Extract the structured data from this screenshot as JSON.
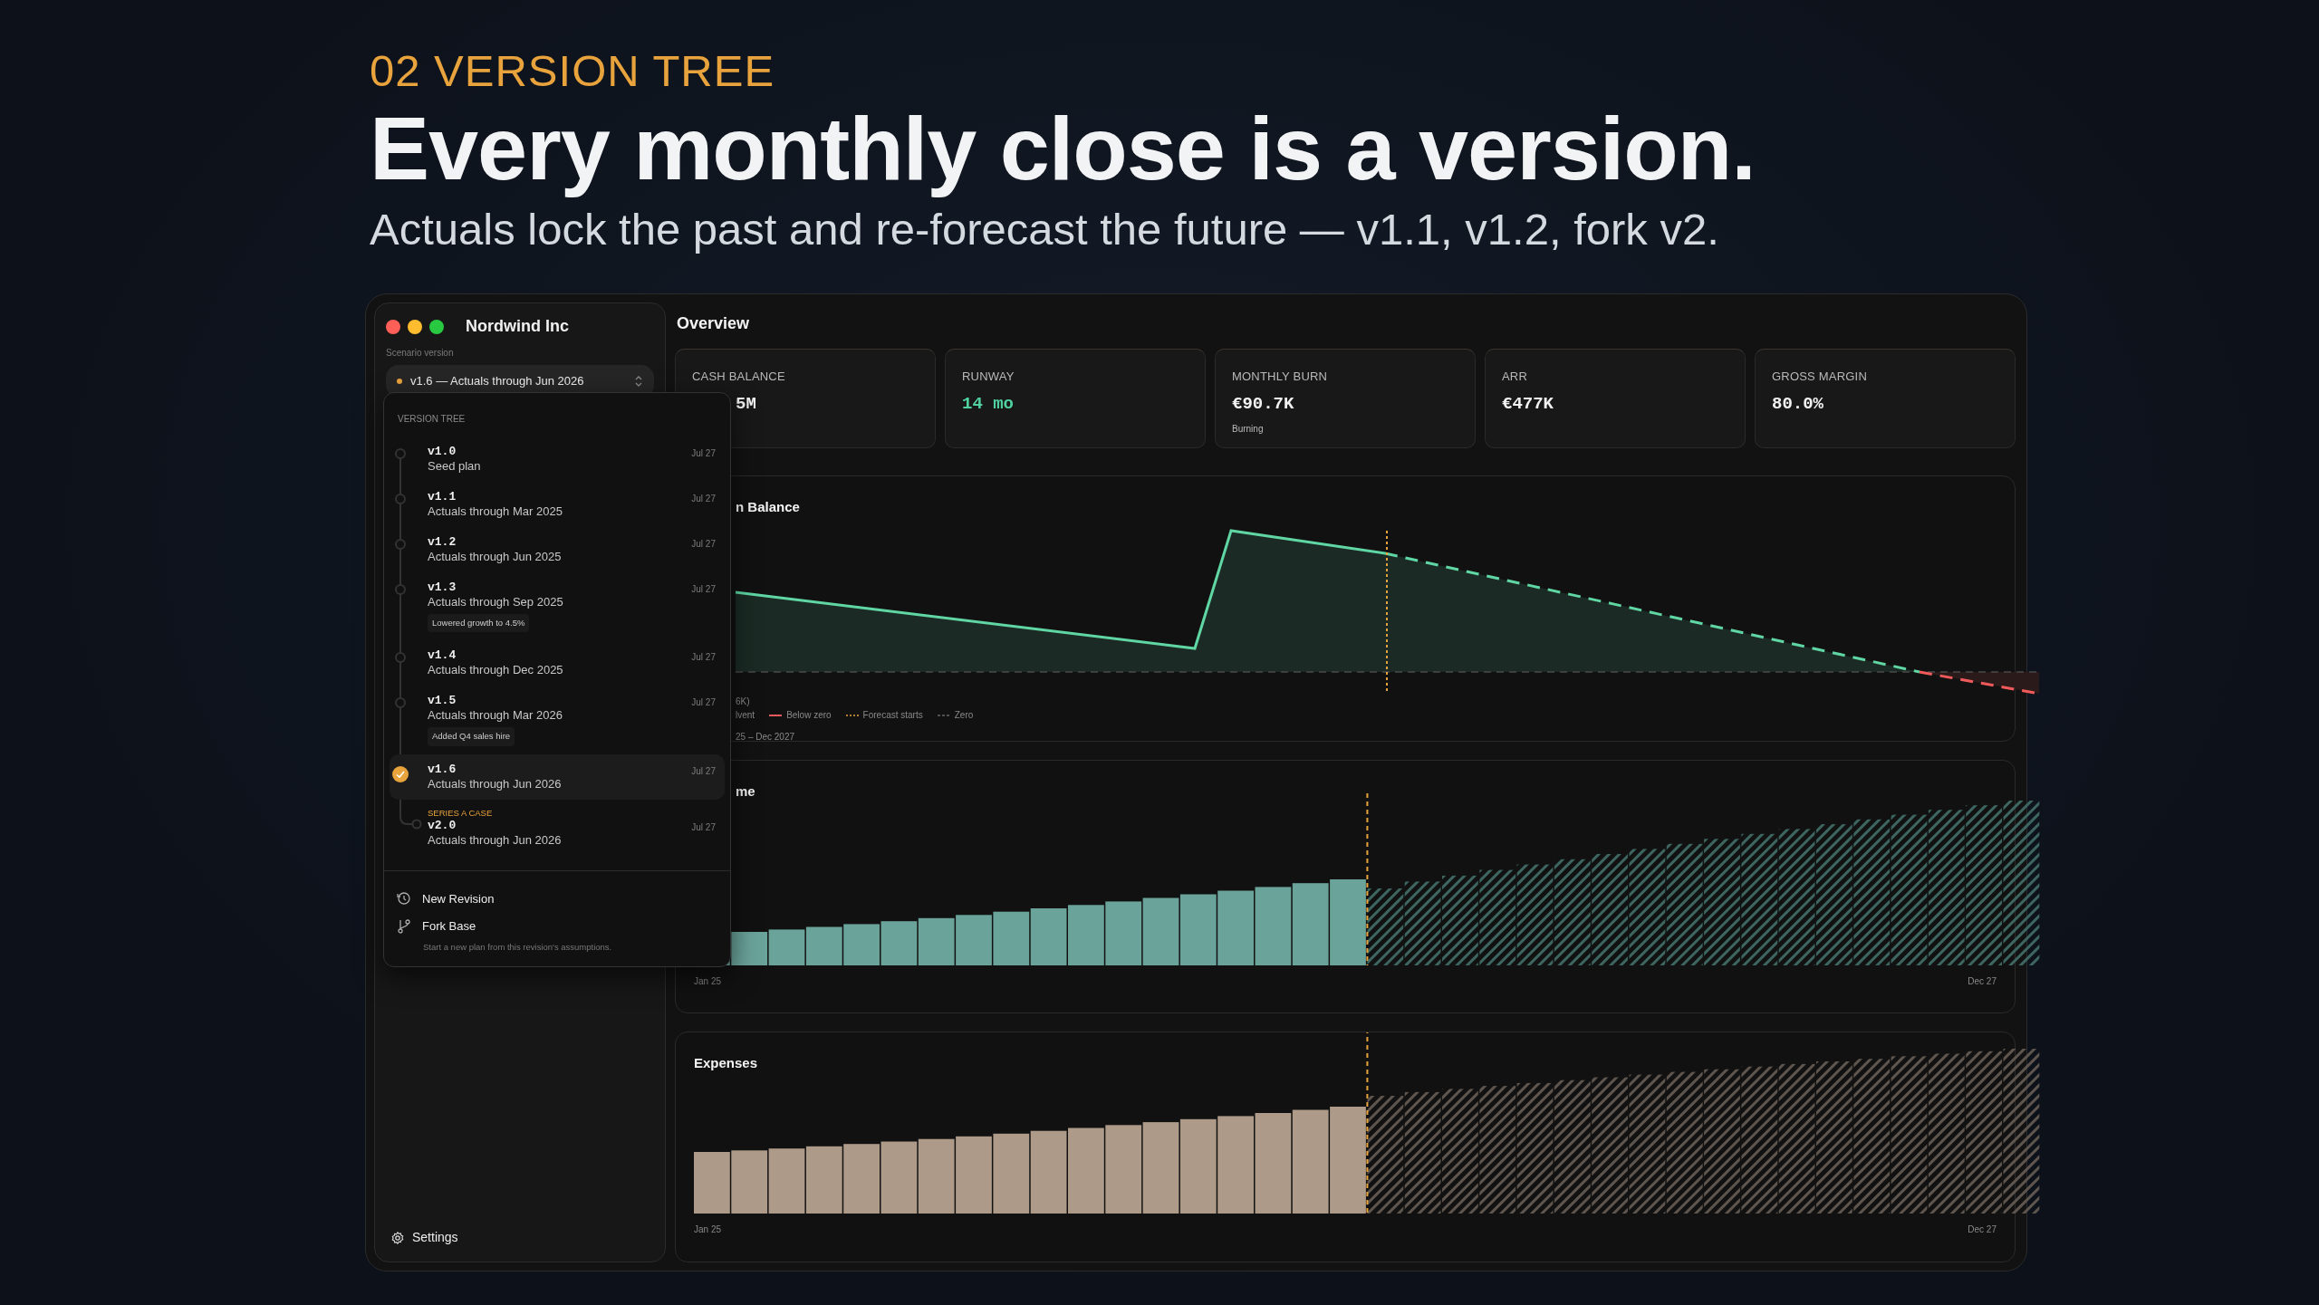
{
  "header": {
    "eyebrow": "02 VERSION TREE",
    "headline": "Every monthly close is a version.",
    "subtitle": "Actuals lock the past and re-forecast the future — v1.1, v1.2, fork v2."
  },
  "sidebar": {
    "company": "Nordwind Inc",
    "scenario_label": "Scenario version",
    "scenario_value": "v1.6 — Actuals through Jun 2026",
    "settings": "Settings"
  },
  "version_menu": {
    "heading": "VERSION TREE",
    "versions": [
      {
        "version": "v1.0",
        "description": "Seed plan",
        "date": "Jul 27",
        "selected": false
      },
      {
        "version": "v1.1",
        "description": "Actuals through Mar 2025",
        "date": "Jul 27",
        "selected": false
      },
      {
        "version": "v1.2",
        "description": "Actuals through Jun 2025",
        "date": "Jul 27",
        "selected": false
      },
      {
        "version": "v1.3",
        "description": "Actuals through Sep 2025",
        "date": "Jul 27",
        "note": "Lowered growth to 4.5%",
        "selected": false
      },
      {
        "version": "v1.4",
        "description": "Actuals through Dec 2025",
        "date": "Jul 27",
        "selected": false
      },
      {
        "version": "v1.5",
        "description": "Actuals through Mar 2026",
        "date": "Jul 27",
        "note": "Added Q4 sales hire",
        "selected": false
      },
      {
        "version": "v1.6",
        "description": "Actuals through Jun 2026",
        "date": "Jul 27",
        "selected": true,
        "children": [
          {
            "tag": "SERIES A CASE",
            "version": "v2.0",
            "description": "Actuals through Jun 2026",
            "date": "Jul 27",
            "selected": false
          }
        ]
      }
    ],
    "actions": [
      {
        "kind": "revision",
        "label": "New Revision"
      },
      {
        "kind": "fork",
        "label": "Fork Base",
        "hint": "Start a new plan from this revision's assumptions."
      }
    ]
  },
  "overview": {
    "title": "Overview",
    "kpis": [
      {
        "label": "CASH BALANCE",
        "value": "5M",
        "color": "#f2f2f2"
      },
      {
        "label": "RUNWAY",
        "value": "14 mo",
        "color": "#4fd1a0"
      },
      {
        "label": "MONTHLY BURN",
        "value": "€90.7K",
        "note": "Burning",
        "color": "#f2f2f2"
      },
      {
        "label": "ARR",
        "value": "€477K",
        "color": "#f2f2f2"
      },
      {
        "label": "GROSS MARGIN",
        "value": "80.0%",
        "color": "#f2f2f2"
      }
    ]
  },
  "cash_chart": {
    "title": "n Balance",
    "legend_head": "6K)",
    "legend": [
      {
        "kind": "clipped",
        "label": "lvent"
      },
      {
        "kind": "below",
        "label": "Below zero"
      },
      {
        "kind": "forecast",
        "label": "Forecast starts"
      },
      {
        "kind": "zero",
        "label": "Zero"
      }
    ],
    "range": "25 – Dec 2027"
  },
  "income_chart": {
    "title": "me",
    "x_start": "Jan 25",
    "x_end": "Dec 27"
  },
  "expenses_chart": {
    "title": "Expenses",
    "x_start": "Jan 25",
    "x_end": "Dec 27"
  }
}
